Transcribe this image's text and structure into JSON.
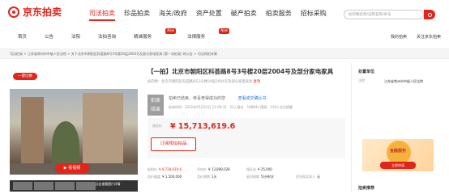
{
  "brand": {
    "name": "京东拍卖"
  },
  "topnav": [
    {
      "label": "司法拍卖",
      "active": true
    },
    {
      "label": "珍品拍卖",
      "active": false
    },
    {
      "label": "海关/政府",
      "active": false
    },
    {
      "label": "资产处置",
      "active": false
    },
    {
      "label": "破产拍卖",
      "active": false
    },
    {
      "label": "拍卖服务",
      "active": false
    },
    {
      "label": "招标采购",
      "active": false
    }
  ],
  "search": {
    "placeholder": "标的物名称/法院名称/条号"
  },
  "subnav": [
    {
      "label": "首页",
      "badge": ""
    },
    {
      "label": "公告",
      "badge": ""
    },
    {
      "label": "法院",
      "badge": ""
    },
    {
      "label": "法拍咨询",
      "badge": ""
    },
    {
      "label": "精准服务",
      "badge": "New"
    },
    {
      "label": "法律服务",
      "badge": "New"
    }
  ],
  "account_links": [
    "我的拍卖",
    "关注京东拍卖"
  ],
  "breadcrumb": "司法拍卖 > 江苏省常州市中级人民法院 > 关于北京市朝阳区科荟路8号3号楼20层2004号及部分家电家具 (第一次拍卖) 的公告 > 司法网拍详情",
  "follow_label": "一键切换",
  "video_label": "▶ 看视频",
  "gallery_hint": "点击查看图片详情",
  "lot": {
    "title": "【一拍】北京市朝阳区科荟路8号3号楼20层2004号及部分家电家具",
    "subtitle": "标的物：北京市朝阳区科荟路8号3号楼20层2004号及部分家电家具",
    "copy_label": "复制",
    "status_line1": "拍卖",
    "status_line2": "结束",
    "status_text": "拍卖已结束，恭喜竞得成功的您",
    "status_link": "查看成交确认书",
    "status_meta": "结束时间：2022年05月23日 11:09:32　21人报名　18884人围观　210人关注提醒",
    "price_label": "成交价",
    "price": "¥ 15,713,619.6",
    "subscribe_label": "订阅相似拍品"
  },
  "details": [
    [
      [
        "起拍价",
        "¥ 9,728,619.6"
      ],
      [
        "评估价",
        "¥ 13,898,028"
      ],
      [
        "保证金",
        "¥ 25,000"
      ],
      [
        "",
        ""
      ]
    ],
    [
      [
        "加价幅度",
        "¥ 1,500,000"
      ],
      [
        "竞价周期",
        "1天"
      ],
      [
        "延时周期",
        "5分钟/次"
      ],
      [
        "优先购买权人",
        "无"
      ]
    ]
  ],
  "side": {
    "title": "处置单位",
    "org_label": "法院",
    "org": "江苏省常州市中级人民法院",
    "promo_title": "金融服务",
    "promo_text": "法拍贷款",
    "promo_button": "立即申请",
    "recommend_title": "拍卖推荐"
  },
  "colors": {
    "accent": "#e1251b",
    "link": "#1d6fd1"
  }
}
